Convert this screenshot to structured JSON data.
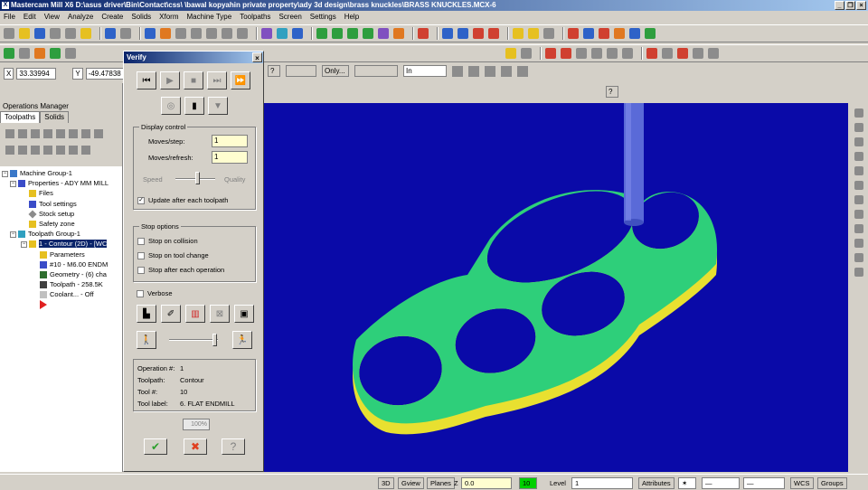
{
  "app": {
    "title": "Mastercam Mill X6  D:\\asus driver\\Bin\\Contact\\css\\ \\bawal kopyahin private property\\ady 3d design\\brass knuckles\\BRASS KNUCKLES.MCX-6",
    "window_buttons": [
      "_",
      "❐",
      "×"
    ]
  },
  "menu": [
    "File",
    "Edit",
    "View",
    "Analyze",
    "Create",
    "Solids",
    "Xform",
    "Machine Type",
    "Toolpaths",
    "Screen",
    "Settings",
    "Help"
  ],
  "coords": {
    "x_label": "X",
    "x_value": "33.33994",
    "y_label": "Y",
    "y_value": "-49.47838"
  },
  "ribbon": {
    "only_label": "Only...",
    "in_label": "In"
  },
  "ops": {
    "title": "Operations Manager",
    "tabs": [
      "Toolpaths",
      "Solids"
    ],
    "tree": [
      {
        "label": "Machine Group-1",
        "level": 0
      },
      {
        "label": "Properties - ADY MM MILL",
        "level": 1
      },
      {
        "label": "Files",
        "level": 2
      },
      {
        "label": "Tool settings",
        "level": 2
      },
      {
        "label": "Stock setup",
        "level": 2
      },
      {
        "label": "Safety zone",
        "level": 2
      },
      {
        "label": "Toolpath Group-1",
        "level": 1
      },
      {
        "label": "1 - Contour (2D) - [WC",
        "level": 2
      },
      {
        "label": "Parameters",
        "level": 3
      },
      {
        "label": "#10 - M6.00 ENDM",
        "level": 3
      },
      {
        "label": "Geometry - (6) cha",
        "level": 3
      },
      {
        "label": "Toolpath - 258.5K",
        "level": 3
      },
      {
        "label": "Coolant... - Off",
        "level": 3
      }
    ]
  },
  "verify": {
    "title": "Verify",
    "close": "×",
    "display_control": "Display control",
    "moves_step_label": "Moves/step:",
    "moves_step_value": "1",
    "moves_refresh_label": "Moves/refresh:",
    "moves_refresh_value": "1",
    "speed_label": "Speed",
    "quality_label": "Quality",
    "update_label": "Update after each toolpath",
    "stop_options": "Stop options",
    "stop_collision": "Stop on collision",
    "stop_tool_change": "Stop on tool change",
    "stop_each_op": "Stop after each operation",
    "verbose": "Verbose",
    "info": {
      "operation_label": "Operation #:",
      "operation_value": "1",
      "toolpath_label": "Toolpath:",
      "toolpath_value": "Contour",
      "tool_label": "Tool #:",
      "tool_value": "10",
      "tool_label_label": "Tool label:",
      "tool_label_value": "6. FLAT ENDMILL"
    },
    "progress": "100%"
  },
  "status": {
    "view3d": "3D",
    "gview": "Gview",
    "planes": "Planes",
    "z_label": "Z",
    "z_value": "0.0",
    "color_value": "10",
    "level_label": "Level",
    "level_value": "1",
    "attributes": "Attributes",
    "wcs": "WCS",
    "groups": "Groups"
  },
  "colors": {
    "viewport_bg": "#0a0aa8",
    "part_top": "#2ecf7a",
    "part_side": "#e8e030",
    "tool": "#5a6ad8"
  }
}
